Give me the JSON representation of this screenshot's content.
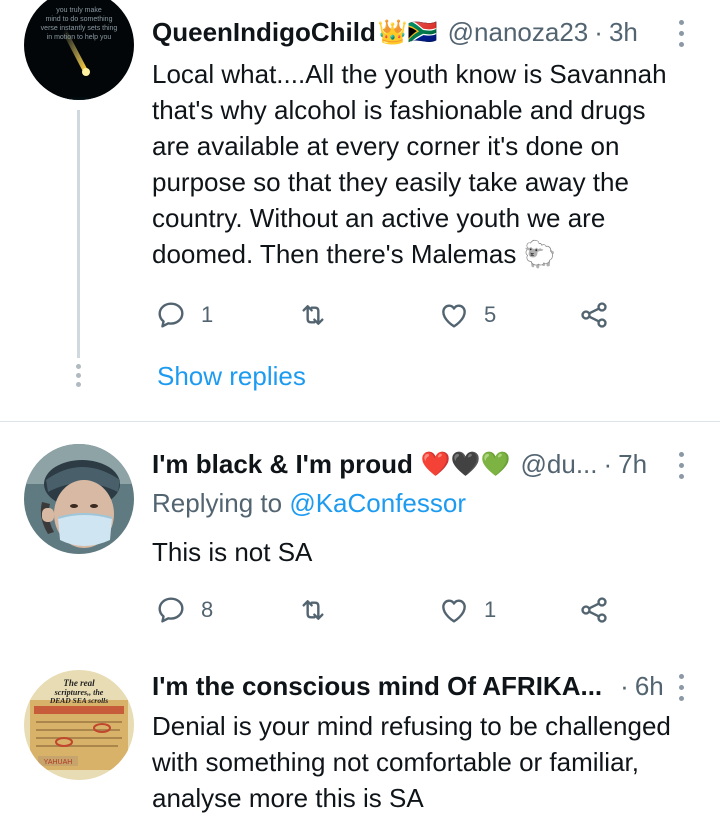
{
  "tweets": [
    {
      "name": "QueenIndigoChild",
      "name_emoji": "👑🇿🇦",
      "handle": "@nanoza23",
      "separator": "·",
      "time": "3h",
      "text": "Local what....All the youth know is Savannah that's why alcohol is fashionable and drugs are available at every corner it's done on purpose so that they easily take away the country. Without an active youth we are doomed. Then there's Malemas 🐑",
      "reply_count": "1",
      "retweet_count": "",
      "like_count": "5",
      "show_replies": "Show replies",
      "avatar_text": "you truly make mind to do something verse instantly sets thing in motion to help you"
    },
    {
      "name": "I'm black & I'm proud",
      "name_emoji": "❤️🖤💚",
      "handle": "@du...",
      "separator": "·",
      "time": "7h",
      "replying_prefix": "Replying to",
      "replying_to": "@KaConfessor",
      "text": "This is not SA",
      "reply_count": "8",
      "retweet_count": "",
      "like_count": "1"
    },
    {
      "name": "I'm the conscious mind Of AFRIKA...",
      "separator": "·",
      "time": "6h",
      "text": "Denial is your mind refusing to be challenged with something not comfortable or familiar, analyse more this is SA",
      "avatar_text_1": "The real",
      "avatar_text_2": "scriptures,, the",
      "avatar_text_3": "DEAD SEA scrolls",
      "avatar_text_4": "YAHUAH"
    }
  ],
  "colors": {
    "link": "#1d9bf0",
    "secondary": "#536471",
    "thread_line": "#cfd9de"
  },
  "icons": [
    "reply-icon",
    "retweet-icon",
    "like-icon",
    "share-icon",
    "more-options-icon"
  ]
}
